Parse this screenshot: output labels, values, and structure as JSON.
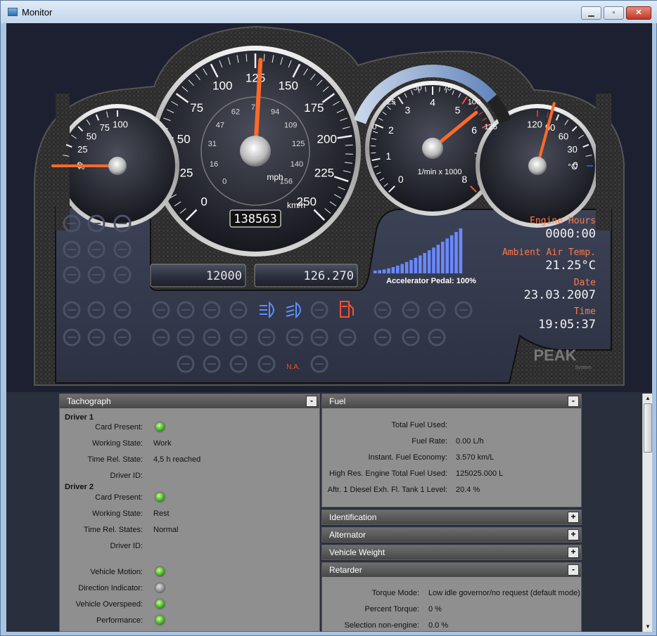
{
  "window": {
    "title": "Monitor",
    "min_glyph": "▁",
    "max_glyph": "▫",
    "close_glyph": "✕"
  },
  "speedometer": {
    "mph_ticks": [
      "0",
      "25",
      "50",
      "75",
      "100",
      "125",
      "150",
      "175",
      "200",
      "225",
      "250"
    ],
    "kmh_ticks": [
      "0",
      "16",
      "31",
      "47",
      "62",
      "78",
      "94",
      "109",
      "125",
      "140",
      "156"
    ],
    "unit_mph": "mph",
    "unit_kmh": "km/h",
    "odometer": "138563",
    "needle_value_mph": 128
  },
  "tachometer": {
    "ticks": [
      "0",
      "1",
      "2",
      "3",
      "4",
      "5",
      "6",
      "7",
      "8"
    ],
    "unit": "1/min x 1000",
    "needle_value": 5.5
  },
  "fuel_gauge": {
    "ticks": [
      "0",
      "25",
      "50",
      "75",
      "100"
    ],
    "unit": "%",
    "needle_value": 0
  },
  "temp_gauge": {
    "ticks": [
      "0",
      "30",
      "60",
      "90",
      "120"
    ],
    "unit": "°C",
    "needle_value": 100
  },
  "load_arc": {
    "ticks": [
      "0",
      "25",
      "50",
      "75",
      "100",
      "125"
    ]
  },
  "trip_displays": {
    "left": "12000",
    "right": "126.270"
  },
  "accelerator": {
    "label": "Accelerator Pedal: 100%",
    "bars": 20
  },
  "info": {
    "engine_hours_label": "Engine Hours",
    "engine_hours": "0000:00",
    "ambient_label": "Ambient Air Temp.",
    "ambient": "21.25°C",
    "date_label": "Date",
    "date": "23.03.2007",
    "time_label": "Time",
    "time": "19:05:37"
  },
  "brand": {
    "logo": "PEAK",
    "sub": "System"
  },
  "na_label": "N.A.",
  "colors": {
    "accent_orange": "#ff6a2a",
    "info_label": "#ff7a4a",
    "led_green": "#3fa81b",
    "indicator_blue": "#5a8fff",
    "indicator_red": "#ff5030"
  },
  "tachograph": {
    "title": "Tachograph",
    "toggle": "-",
    "driver1": {
      "heading": "Driver 1",
      "card_present_label": "Card Present:",
      "working_state_label": "Working State:",
      "working_state": "Work",
      "time_rel_label": "Time Rel. State:",
      "time_rel": "4,5 h reached",
      "driver_id_label": "Driver ID:"
    },
    "driver2": {
      "heading": "Driver 2",
      "card_present_label": "Card Present:",
      "working_state_label": "Working State:",
      "working_state": "Rest",
      "time_rel_label": "Time Rel. States:",
      "time_rel": "Normal",
      "driver_id_label": "Driver ID:"
    },
    "vehicle_motion_label": "Vehicle Motion:",
    "direction_label": "Direction Indicator:",
    "overspeed_label": "Vehicle Overspeed:",
    "performance_label": "Performance:"
  },
  "fuel": {
    "title": "Fuel",
    "toggle": "-",
    "rows": [
      {
        "label": "Total Fuel Used:",
        "value": ""
      },
      {
        "label": "Fuel Rate:",
        "value": "0.00 L/h"
      },
      {
        "label": "Instant. Fuel Economy:",
        "value": "3.570 km/L"
      },
      {
        "label": "High Res. Engine Total Fuel Used:",
        "value": "125025.000 L"
      },
      {
        "label": "Aftr. 1 Diesel Exh. Fl. Tank 1 Level:",
        "value": "20.4 %"
      }
    ]
  },
  "collapsed_sections": [
    {
      "title": "Identification",
      "toggle": "+"
    },
    {
      "title": "Alternator",
      "toggle": "+"
    },
    {
      "title": "Vehicle Weight",
      "toggle": "+"
    }
  ],
  "retarder": {
    "title": "Retarder",
    "toggle": "-",
    "rows": [
      {
        "label": "Torque Mode:",
        "value": "Low idle governor/no request (default mode)"
      },
      {
        "label": "Percent Torque:",
        "value": "0 %"
      },
      {
        "label": "Selection non-engine:",
        "value": "0.0 %"
      }
    ]
  },
  "scrollbar": {
    "up": "▲",
    "down": "▼"
  }
}
